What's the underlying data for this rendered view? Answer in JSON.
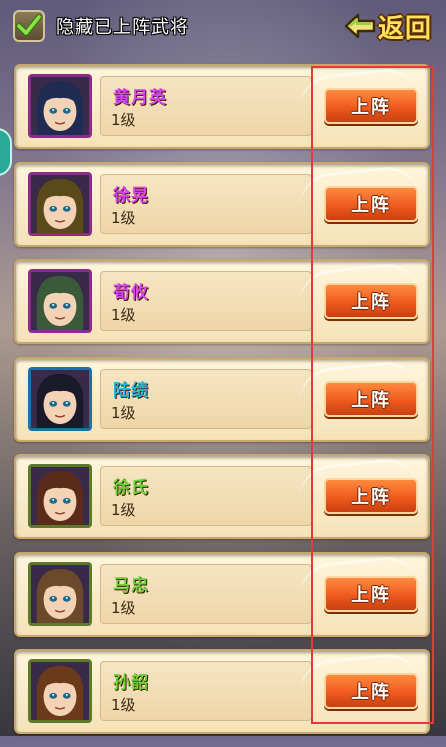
{
  "header": {
    "hide_label": "隐藏已上阵武将",
    "back_label": "返回",
    "checkbox_checked": true
  },
  "generals": [
    {
      "name": "黄月英",
      "level": "1级",
      "name_color": "#d946ef",
      "frame_color": "#8b2c89",
      "button": "上阵"
    },
    {
      "name": "徐晃",
      "level": "1级",
      "name_color": "#d946ef",
      "frame_color": "#8b2c89",
      "button": "上阵"
    },
    {
      "name": "荀攸",
      "level": "1级",
      "name_color": "#d946ef",
      "frame_color": "#8b2c89",
      "button": "上阵"
    },
    {
      "name": "陆绩",
      "level": "1级",
      "name_color": "#22b8e6",
      "frame_color": "#1f6fa8",
      "button": "上阵"
    },
    {
      "name": "徐氏",
      "level": "1级",
      "name_color": "#6fd03a",
      "frame_color": "#5c7a2a",
      "button": "上阵"
    },
    {
      "name": "马忠",
      "level": "1级",
      "name_color": "#6fd03a",
      "frame_color": "#5c7a2a",
      "button": "上阵"
    },
    {
      "name": "孙韶",
      "level": "1级",
      "name_color": "#6fd03a",
      "frame_color": "#5c7a2a",
      "button": "上阵"
    }
  ]
}
